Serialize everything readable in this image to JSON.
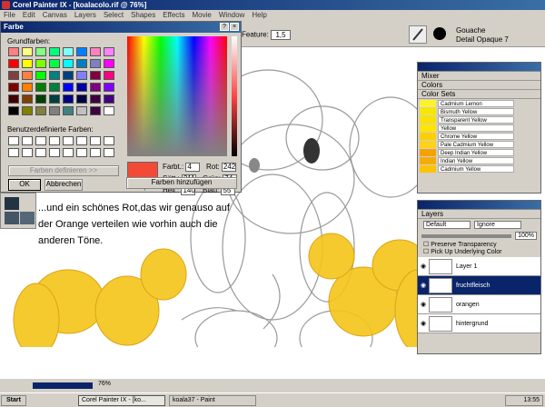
{
  "window": {
    "title": "Corel Painter IX - [koalacolo.rif @ 76%]"
  },
  "menu": [
    "File",
    "Edit",
    "Canvas",
    "Layers",
    "Select",
    "Shapes",
    "Effects",
    "Movie",
    "Window",
    "Help"
  ],
  "toolbar": {
    "feature_label": "Feature:",
    "feature_value": "1,5",
    "brush_category": "Gouache",
    "brush_variant": "Detail Opaque 7"
  },
  "color_dialog": {
    "title": "Farbe",
    "basic_label": "Grundfarben:",
    "custom_label": "Benutzerdefinierte Farben:",
    "define_button": "Farben definieren >>",
    "ok_button": "OK",
    "cancel_button": "Abbrechen",
    "add_button": "Farben hinzufügen",
    "sample_label": "Farbe|Basis",
    "fields": {
      "hue_label": "Farbt.:",
      "hue": "4",
      "sat_label": "Sätt.:",
      "sat": "211",
      "lum_label": "Hell.:",
      "lum": "140",
      "red_label": "Rot:",
      "red": "242",
      "green_label": "Grün:",
      "green": "74",
      "blue_label": "Blau:",
      "blue": "55"
    },
    "basic_colors": [
      "#ff8080",
      "#ffff80",
      "#80ff80",
      "#00ff80",
      "#80ffff",
      "#0080ff",
      "#ff80c0",
      "#ff80ff",
      "#ff0000",
      "#ffff00",
      "#80ff00",
      "#00ff40",
      "#00ffff",
      "#0080c0",
      "#8080c0",
      "#ff00ff",
      "#804040",
      "#ff8040",
      "#00ff00",
      "#008080",
      "#004080",
      "#8080ff",
      "#800040",
      "#ff0080",
      "#800000",
      "#ff8000",
      "#008000",
      "#008040",
      "#0000ff",
      "#0000a0",
      "#800080",
      "#8000ff",
      "#400000",
      "#804000",
      "#004000",
      "#004040",
      "#000080",
      "#000040",
      "#400040",
      "#400080",
      "#000000",
      "#808000",
      "#808040",
      "#808080",
      "#408080",
      "#c0c0c0",
      "#400040",
      "#ffffff"
    ],
    "custom_colors": [
      "#ffffff",
      "#ffffff",
      "#ffffff",
      "#ffffff",
      "#ffffff",
      "#ffffff",
      "#ffffff",
      "#ffffff",
      "#ffffff",
      "#ffffff",
      "#ffffff",
      "#ffffff",
      "#ffffff",
      "#ffffff",
      "#ffffff",
      "#ffffff"
    ],
    "selected_color": "#f24a37"
  },
  "caption": "...und ein schönes Rot,das wir genauso auf der Orange verteilen wie vorhin auch die anderen Töne.",
  "panels": {
    "mixer": "Mixer",
    "colors": "Colors",
    "color_sets": "Color Sets",
    "color_set_items": [
      {
        "name": "Cadmium Lemon",
        "color": "#fdf32a"
      },
      {
        "name": "Bismuth Yellow",
        "color": "#f8e700"
      },
      {
        "name": "Transparent Yellow",
        "color": "#fae100"
      },
      {
        "name": "Yellow",
        "color": "#ffe400"
      },
      {
        "name": "Chrome Yellow",
        "color": "#fcd000"
      },
      {
        "name": "Pale Cadmium Yellow",
        "color": "#fcd31a"
      },
      {
        "name": "Deep Indian Yellow",
        "color": "#f6a100"
      },
      {
        "name": "Indian Yellow",
        "color": "#f5ac0a"
      },
      {
        "name": "Cadmium Yellow",
        "color": "#fcc400"
      }
    ],
    "layers_title": "Layers",
    "composite_method": "Default",
    "composite_depth": "Ignore",
    "opacity": "100%",
    "preserve_transparency": "Preserve Transparency",
    "pick_up_underlying": "Pick Up Underlying Color",
    "layers": [
      {
        "name": "Layer 1",
        "selected": false
      },
      {
        "name": "fruchtfleisch",
        "selected": true
      },
      {
        "name": "orangen",
        "selected": false
      },
      {
        "name": "hintergrund",
        "selected": false
      }
    ]
  },
  "status": {
    "zoom": "76%"
  },
  "taskbar": {
    "start": "Start",
    "tasks": [
      "Corel Painter IX - [ko...",
      "koala37 - Paint"
    ],
    "clock": "13:55"
  }
}
